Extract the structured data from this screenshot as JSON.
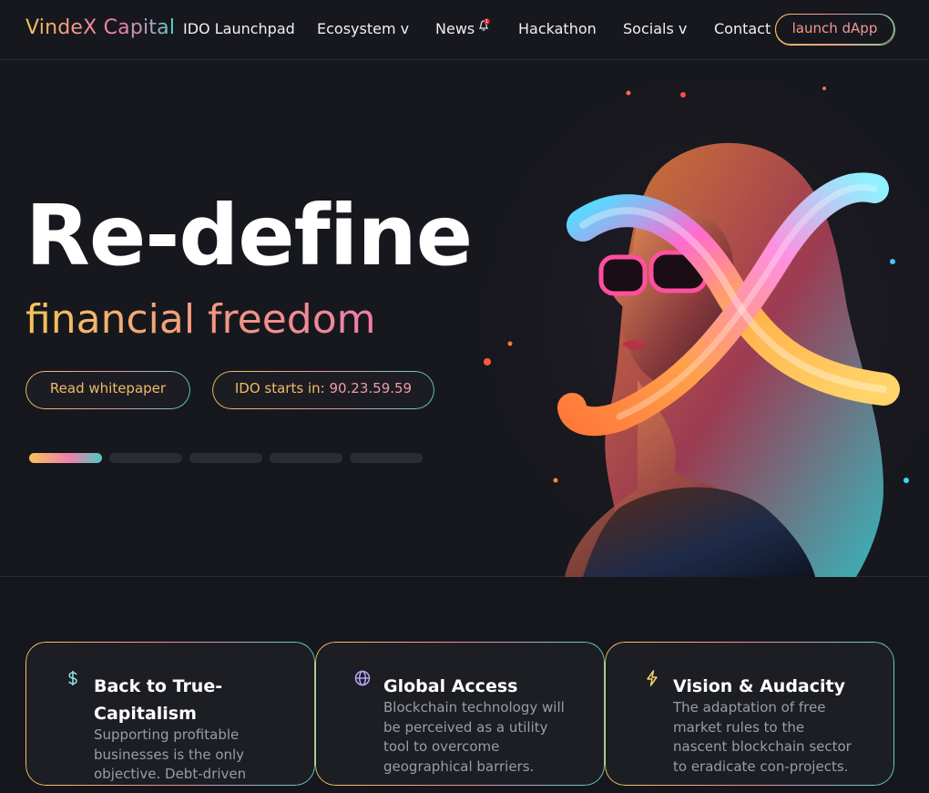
{
  "header": {
    "logo": "VindeX Capital",
    "nav": [
      {
        "label": "IDO Launchpad"
      },
      {
        "label": "Ecosystem v"
      },
      {
        "label": "News"
      },
      {
        "label": "Hackathon"
      },
      {
        "label": "Socials v"
      },
      {
        "label": "Contact"
      }
    ],
    "news_badge": "1",
    "dapp_button": "launch dApp"
  },
  "hero": {
    "title": "Re-define",
    "subtitle": "financial freedom",
    "whitepaper_button": "Read whitepaper",
    "ido_label": "IDO starts in:",
    "ido_countdown": "90.23.59.59",
    "slides": [
      {
        "active": true
      },
      {
        "active": false
      },
      {
        "active": false
      },
      {
        "active": false
      },
      {
        "active": false
      }
    ]
  },
  "features": [
    {
      "icon": "dollar-icon",
      "title": "Back to True-Capitalism",
      "text": "Supporting profitable businesses is the only objective. Debt-driven business models will be"
    },
    {
      "icon": "globe-icon",
      "title": "Global Access",
      "text": "Blockchain technology will be perceived as a utility tool to overcome geographical barriers."
    },
    {
      "icon": "lightning-icon",
      "title": "Vision & Audacity",
      "text": "The adaptation of free market rules to the nascent blockchain sector to eradicate con-projects."
    }
  ],
  "colors": {
    "background": "#16171c",
    "gradient_gold": "#f6c45a",
    "gradient_pink": "#ee7fb0",
    "gradient_teal": "#59d3c8"
  }
}
